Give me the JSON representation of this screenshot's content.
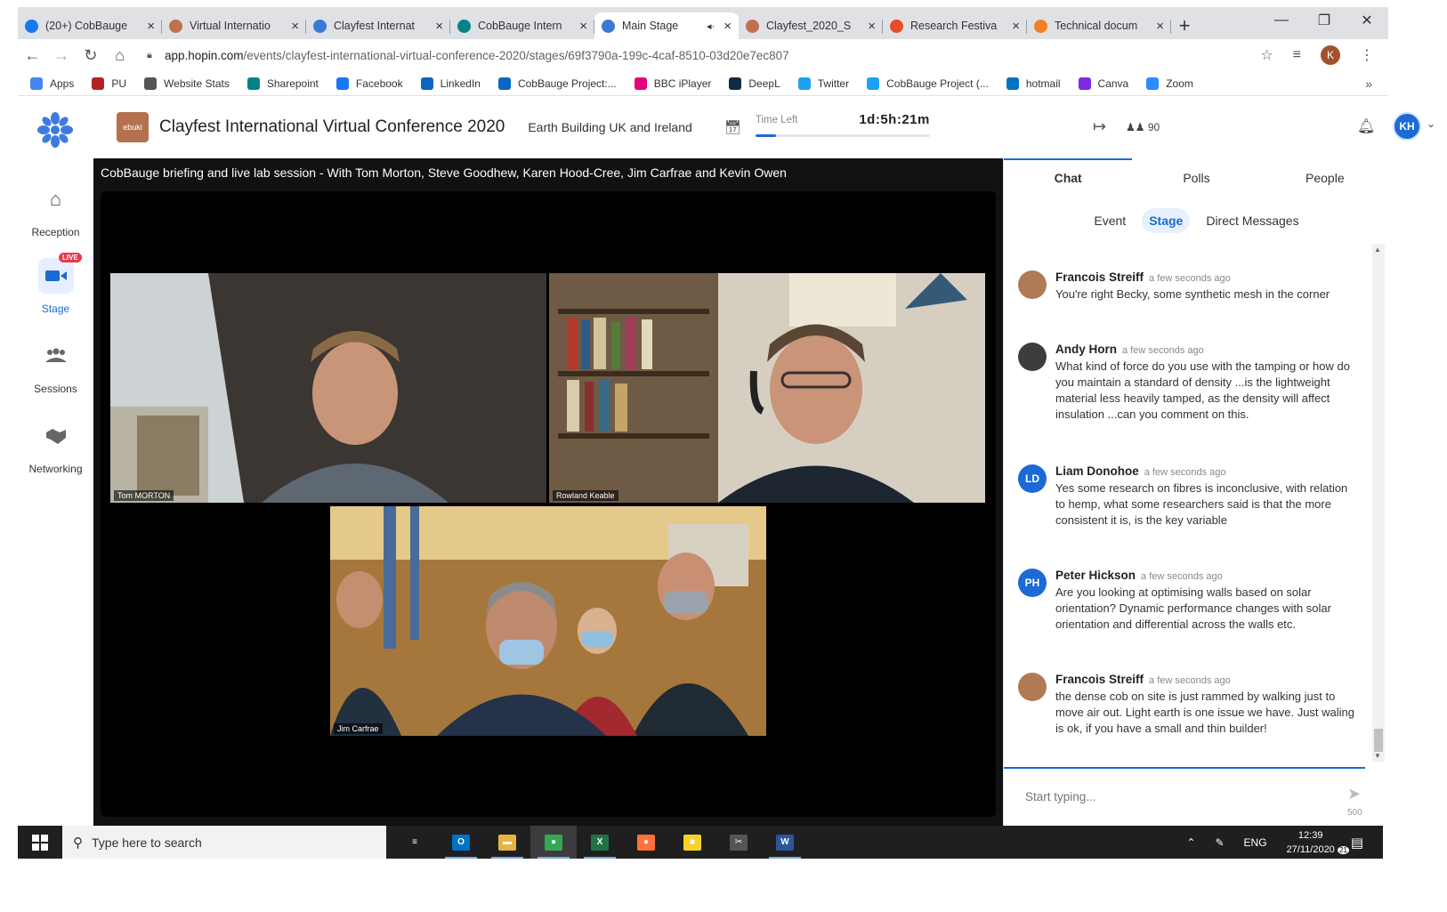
{
  "browser": {
    "tabs": [
      {
        "label": "(20+) CobBauge",
        "icon": "facebook-icon",
        "color": "#1877f2",
        "active": false
      },
      {
        "label": "Virtual Internatio",
        "icon": "hopin-icon",
        "color": "#c0704e",
        "active": false
      },
      {
        "label": "Clayfest Internat",
        "icon": "hopin-icon",
        "color": "#3a7bd5",
        "active": false
      },
      {
        "label": "CobBauge Intern",
        "icon": "sharepoint-icon",
        "color": "#038387",
        "active": false
      },
      {
        "label": "Main Stage",
        "icon": "hopin-icon",
        "color": "#3a7bd5",
        "active": true,
        "audio": "◂·"
      },
      {
        "label": "Clayfest_2020_S",
        "icon": "hopin-icon",
        "color": "#c0704e",
        "active": false
      },
      {
        "label": "Research Festiva",
        "icon": "j-icon",
        "color": "#e44d26",
        "active": false
      },
      {
        "label": "Technical docum",
        "icon": "stack-icon",
        "color": "#f48024",
        "active": false
      }
    ],
    "url_host": "app.hopin.com",
    "url_path": "/events/clayfest-international-virtual-conference-2020/stages/69f3790a-199c-4caf-8510-03d20e7ec807",
    "profile_initial": "K",
    "bookmarks": [
      {
        "label": "Apps",
        "color": "#4285f4"
      },
      {
        "label": "PU",
        "color": "#b22222"
      },
      {
        "label": "Website Stats",
        "color": "#555555"
      },
      {
        "label": "Sharepoint",
        "color": "#038387"
      },
      {
        "label": "Facebook",
        "color": "#1877f2"
      },
      {
        "label": "LinkedIn",
        "color": "#0a66c2"
      },
      {
        "label": "CobBauge Project:...",
        "color": "#0a66c2"
      },
      {
        "label": "BBC iPlayer",
        "color": "#e6007e"
      },
      {
        "label": "DeepL",
        "color": "#0f2b46"
      },
      {
        "label": "Twitter",
        "color": "#1da1f2"
      },
      {
        "label": "CobBauge Project (...",
        "color": "#1da1f2"
      },
      {
        "label": "hotmail",
        "color": "#0072c6"
      },
      {
        "label": "Canva",
        "color": "#7d2ae8"
      },
      {
        "label": "Zoom",
        "color": "#2d8cff"
      }
    ],
    "more_bookmarks": "»"
  },
  "nav": {
    "items": [
      {
        "label": "Reception",
        "icon": "home-icon",
        "glyph": "⌂"
      },
      {
        "label": "Stage",
        "icon": "camera-icon",
        "glyph": "■",
        "badge": "LIVE"
      },
      {
        "label": "Sessions",
        "icon": "group-icon",
        "glyph": "⚇"
      },
      {
        "label": "Networking",
        "icon": "handshake-icon",
        "glyph": "✋"
      }
    ]
  },
  "header": {
    "org_logo_text": "ebuki",
    "event_title": "Clayfest International Virtual Conference 2020",
    "org_name": "Earth Building UK and Ireland",
    "time_left_label": "Time Left",
    "time_left_value": "1d:5h:21m",
    "time_progress": 0.12,
    "attendee_count": "90",
    "user_initials": "KH"
  },
  "stage": {
    "title": "CobBauge briefing and live lab session - With Tom Morton, Steve Goodhew, Karen Hood-Cree, Jim Carfrae and Kevin Owen",
    "participants": [
      {
        "name": "Tom MORTON"
      },
      {
        "name": "Rowland Keable"
      },
      {
        "name": "Jim Carfrae"
      }
    ]
  },
  "chat": {
    "main_tabs": [
      "Chat",
      "Polls",
      "People"
    ],
    "sub_tabs": [
      "Event",
      "Stage",
      "Direct Messages"
    ],
    "messages": [
      {
        "name": "Francois Streiff",
        "time": "a few seconds ago",
        "initials": "",
        "color": "#b07a55",
        "text": "You're right Becky, some synthetic mesh in the corner"
      },
      {
        "name": "Andy Horn",
        "time": "a few seconds ago",
        "initials": "",
        "color": "#3d3d3d",
        "text": "What kind of force do you use with the tamping or how do you maintain a standard of density ...is the lightweight material less heavily tamped, as the density will affect insulation ...can you comment on this."
      },
      {
        "name": "Liam Donohoe",
        "time": "a few seconds ago",
        "initials": "LD",
        "color": "#1b6ad6",
        "text": "Yes some research on fibres is inconclusive, with relation to hemp, what some researchers said is that the more consistent it is, is the key variable"
      },
      {
        "name": "Peter Hickson",
        "time": "a few seconds ago",
        "initials": "PH",
        "color": "#1b6ad6",
        "text": "Are you looking at optimising walls based on solar orientation? Dynamic performance changes with solar orientation and differential across the walls etc."
      },
      {
        "name": "Francois Streiff",
        "time": "a few seconds ago",
        "initials": "",
        "color": "#b07a55",
        "text": "the dense cob on site is just rammed by walking just to move air out. Light earth is one issue we have. Just waling is ok, if you have a small and thin builder!"
      }
    ],
    "input_placeholder": "Start typing...",
    "char_limit": "500"
  },
  "taskbar": {
    "search_placeholder": "Type here to search",
    "apps": [
      {
        "icon": "task-view-icon",
        "glyph": "≡",
        "color": "#1f1f1f",
        "open": false
      },
      {
        "icon": "outlook-icon",
        "glyph": "O",
        "color": "#0072c6",
        "open": true
      },
      {
        "icon": "file-explorer-icon",
        "glyph": "▬",
        "color": "#e8b440",
        "open": true
      },
      {
        "icon": "chrome-icon",
        "glyph": "●",
        "color": "#34a853",
        "open": true,
        "active": true
      },
      {
        "icon": "excel-icon",
        "glyph": "X",
        "color": "#217346",
        "open": true
      },
      {
        "icon": "firefox-icon",
        "glyph": "●",
        "color": "#ff7139",
        "open": false
      },
      {
        "icon": "sticky-notes-icon",
        "glyph": "■",
        "color": "#f7d32a",
        "open": false
      },
      {
        "icon": "snipping-tool-icon",
        "glyph": "✂",
        "color": "#555555",
        "open": false
      },
      {
        "icon": "word-icon",
        "glyph": "W",
        "color": "#2b579a",
        "open": true
      }
    ],
    "language": "ENG",
    "time": "12:39",
    "date": "27/11/2020",
    "notifications": "21"
  }
}
